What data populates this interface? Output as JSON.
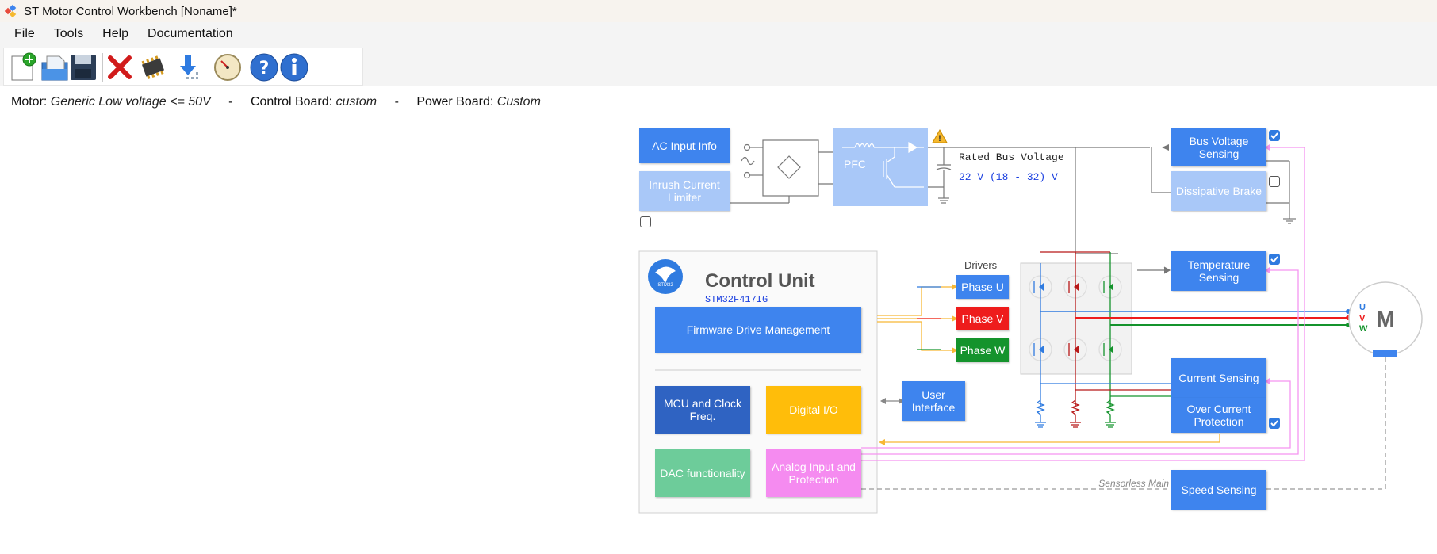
{
  "window": {
    "title": "ST Motor Control Workbench [Noname]*"
  },
  "menu": {
    "file": "File",
    "tools": "Tools",
    "help": "Help",
    "documentation": "Documentation"
  },
  "toolbar": {
    "icons": [
      "new-project-icon",
      "open-project-icon",
      "save-icon",
      "close-icon",
      "chip-icon",
      "download-icon",
      "monitor-gauge-icon",
      "help-icon",
      "info-icon"
    ]
  },
  "info": {
    "motor_label": "Motor:",
    "motor_value": "Generic Low voltage <= 50V",
    "sep1": "-",
    "control_label": "Control Board:",
    "control_value": "custom",
    "sep2": "-",
    "power_label": "Power Board:",
    "power_value": "Custom"
  },
  "diagram": {
    "ac_input": "AC Input Info",
    "inrush": "Inrush Current Limiter",
    "pfc": "PFC",
    "rated_bus_label": "Rated Bus Voltage",
    "rated_bus_value": "22 V (18 - 32) V",
    "bus_voltage": "Bus Voltage Sensing",
    "dissipative": "Dissipative Brake",
    "control_unit_title": "Control Unit",
    "mcu_part": "STM32F417IG",
    "logo_text": "STM32",
    "firmware": "Firmware Drive Management",
    "mcu_clock": "MCU and Clock Freq.",
    "digital_io": "Digital I/O",
    "dac": "DAC functionality",
    "analog": "Analog Input and Protection",
    "user_interface": "User Interface",
    "drivers": "Drivers",
    "phase_u": "Phase U",
    "phase_v": "Phase V",
    "phase_w": "Phase W",
    "temperature": "Temperature Sensing",
    "current": "Current Sensing",
    "overcurrent": "Over Current Protection",
    "speed": "Speed Sensing",
    "sensorless": "Sensorless Main",
    "motor": "M",
    "u": "U",
    "v": "V",
    "w": "W",
    "checkboxes": {
      "inrush": false,
      "bus_voltage": true,
      "dissipative": false,
      "temperature": true,
      "overcurrent": true
    },
    "colors": {
      "blue": "#3e84ee",
      "light_blue": "#a9c8f8",
      "phase_v": "#ee1c1c",
      "phase_w": "#14932c",
      "digital_io": "#ffbd0a",
      "dac": "#6dcc9a",
      "analog": "#f58bf0",
      "mcu": "#2f63c2",
      "pink_line": "#f595f0",
      "yellow_line": "#f7b835"
    }
  }
}
